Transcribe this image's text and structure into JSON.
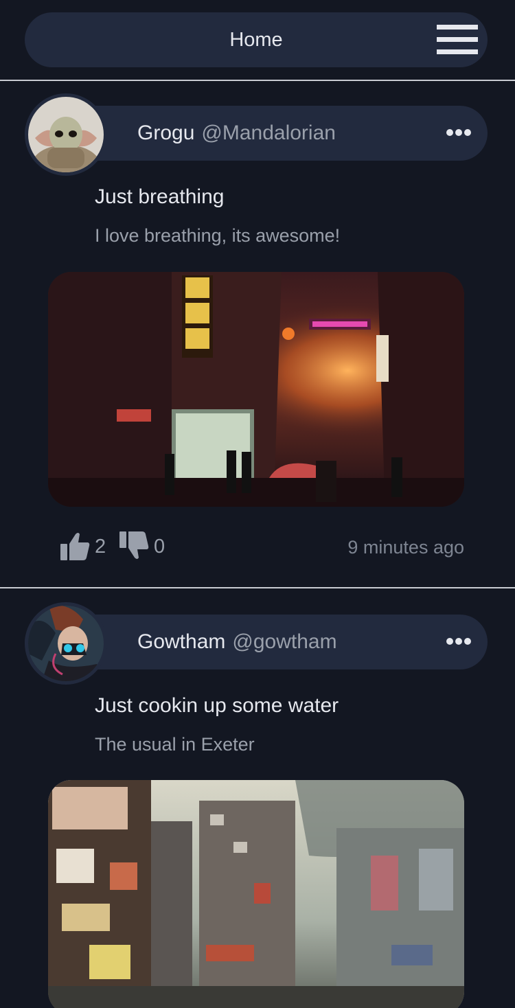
{
  "header": {
    "title": "Home",
    "menu_icon": "hamburger-menu-icon"
  },
  "posts": [
    {
      "author_name": "Grogu",
      "author_handle": "@Mandalorian",
      "title": "Just breathing",
      "body": "I love breathing, its awesome!",
      "likes": "2",
      "dislikes": "0",
      "timestamp": "9 minutes ago"
    },
    {
      "author_name": "Gowtham",
      "author_handle": "@gowtham",
      "title": "Just cookin up some water",
      "body": "The usual in Exeter"
    }
  ],
  "colors": {
    "background": "#131722",
    "bar": "#222a3e",
    "text_primary": "#e6e8ee",
    "text_secondary": "#9aa0ab"
  }
}
